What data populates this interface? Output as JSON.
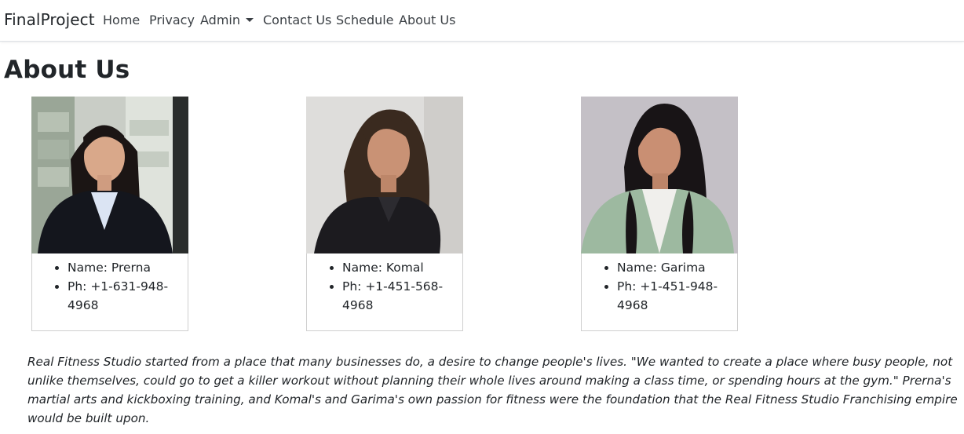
{
  "navbar": {
    "brand": "FinalProject",
    "links": {
      "home": "Home",
      "privacy": "Privacy",
      "admin": "Admin",
      "contact": "Contact Us",
      "schedule": "Schedule",
      "about": "About Us"
    }
  },
  "page": {
    "title": "About Us"
  },
  "team": [
    {
      "name": "Name: Prerna",
      "phone": "Ph: +1-631-948-4968",
      "photo": "portrait of Prerna"
    },
    {
      "name": "Name: Komal",
      "phone": "Ph: +1-451-568-4968",
      "photo": "portrait of Komal"
    },
    {
      "name": "Name: Garima",
      "phone": "Ph: +1-451-948-4968",
      "photo": "portrait of Garima"
    }
  ],
  "about_text": "Real Fitness Studio started from a place that many businesses do, a desire to change people's lives. \"We wanted to create a place where busy people, not unlike themselves, could go to get a killer workout without planning their whole lives around making a class time, or spending hours at the gym.\" Prerna's martial arts and kickboxing training, and Komal's and Garima's own passion for fitness were the foundation that the Real Fitness Studio Franchising empire would be built upon.",
  "colors": {
    "text": "#212529",
    "nav_text": "#3a3f44",
    "border": "#cfcfcf"
  }
}
